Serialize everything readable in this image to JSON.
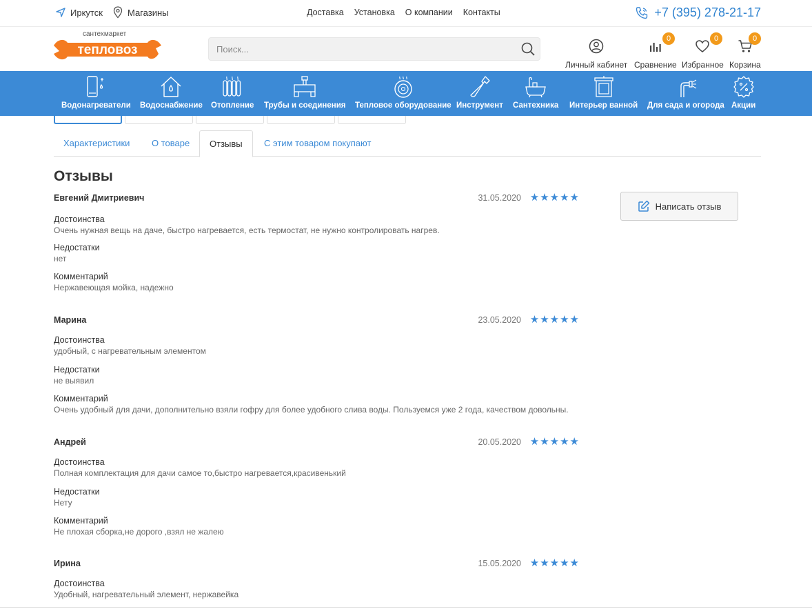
{
  "topbar": {
    "city": "Иркутск",
    "shops": "Магазины",
    "nav": [
      "Доставка",
      "Установка",
      "О компании",
      "Контакты"
    ],
    "phone": "+7 (395) 278-21-17"
  },
  "header": {
    "logo_sub": "сантехмаркет",
    "logo_name": "тепловоз",
    "search_placeholder": "Поиск...",
    "account": "Личный кабинет",
    "compare": "Сравнение",
    "compare_count": "0",
    "favorites": "Избранное",
    "favorites_count": "0",
    "cart": "Корзина",
    "cart_count": "0"
  },
  "categories": [
    {
      "label": "Водонагреватели",
      "icon": "water-heater-icon"
    },
    {
      "label": "Водоснабжение",
      "icon": "water-supply-icon"
    },
    {
      "label": "Отопление",
      "icon": "radiator-icon"
    },
    {
      "label": "Трубы и соединения",
      "icon": "pipes-icon"
    },
    {
      "label": "Тепловое оборудование",
      "icon": "heat-equipment-icon"
    },
    {
      "label": "Инструмент",
      "icon": "wrench-icon"
    },
    {
      "label": "Сантехника",
      "icon": "bathtub-icon"
    },
    {
      "label": "Интерьер ванной",
      "icon": "bathroom-cabinet-icon"
    },
    {
      "label": "Для сада и огорода",
      "icon": "garden-icon"
    },
    {
      "label": "Акции",
      "icon": "discount-icon"
    }
  ],
  "tabs": [
    "Характеристики",
    "О товаре",
    "Отзывы",
    "С этим товаром покупают"
  ],
  "active_tab": "Отзывы",
  "section_title": "Отзывы",
  "write_review": "Написать отзыв",
  "labels": {
    "pros": "Достоинства",
    "cons": "Недостатки",
    "comment": "Комментарий"
  },
  "reviews": [
    {
      "author": "Евгений Дмитриевич",
      "date": "31.05.2020",
      "rating": 5,
      "pros": "Очень нужная вещь на даче, быстро нагревается, есть термостат, не нужно контролировать нагрев.",
      "cons": "нет",
      "comment": "Нержавеющая мойка, надежно"
    },
    {
      "author": "Марина",
      "date": "23.05.2020",
      "rating": 5,
      "pros": "удобный, с нагревательным элементом",
      "cons": "не выявил",
      "comment": "Очень удобный для дачи, дополнительно взяли гофру для более удобного слива воды. Пользуемся уже 2 года, качеством довольны."
    },
    {
      "author": "Андрей",
      "date": "20.05.2020",
      "rating": 5,
      "pros": "Полная комплектация для дачи самое то,быстро нагревается,красивенький",
      "cons": "Нету",
      "comment": "Не плохая сборка,не дорого ,взял не жалею"
    },
    {
      "author": "Ирина",
      "date": "15.05.2020",
      "rating": 5,
      "pros": "Удобный, нагревательный элемент, нержавейка",
      "cons": "",
      "comment": ""
    }
  ],
  "colors": {
    "brand_blue": "#3c8ad6",
    "badge_orange": "#f29a1b",
    "logo_orange": "#f47b20"
  }
}
